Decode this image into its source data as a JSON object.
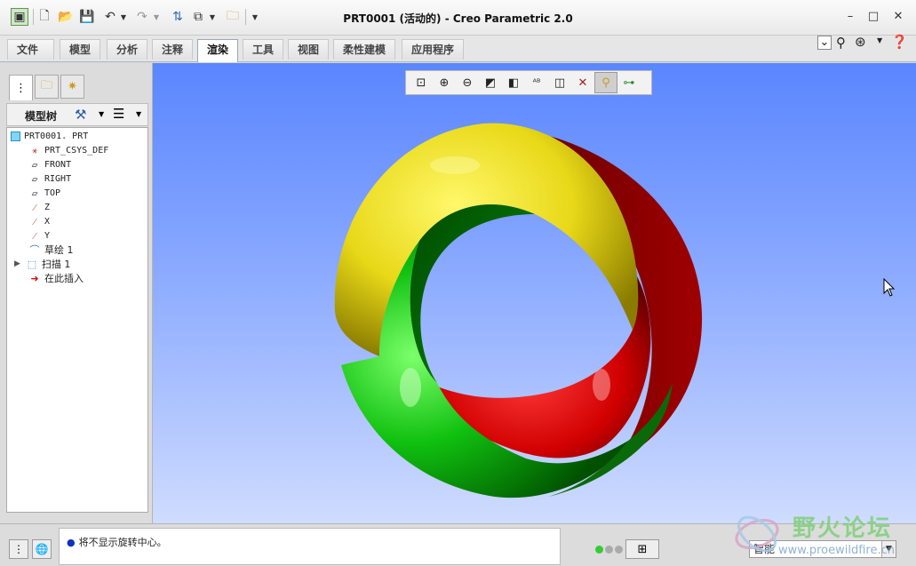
{
  "window": {
    "title": "PRT0001 (活动的) - Creo Parametric 2.0",
    "controls": [
      "–",
      "□",
      "✕"
    ]
  },
  "quick_access": [
    "new-icon",
    "open-icon",
    "save-icon",
    "undo-icon",
    "redo-icon",
    "regenerate-icon",
    "windows-icon",
    "close-window-icon",
    "customize-icon"
  ],
  "tabs": [
    {
      "label": "文件",
      "dropdown": "▾"
    },
    {
      "label": "模型"
    },
    {
      "label": "分析"
    },
    {
      "label": "注释"
    },
    {
      "label": "渲染"
    },
    {
      "label": "工具"
    },
    {
      "label": "视图"
    },
    {
      "label": "柔性建模"
    },
    {
      "label": "应用程序"
    }
  ],
  "active_tab": "渲染",
  "left_panel": {
    "header": "模型树",
    "tree": [
      {
        "label": "PRT0001. PRT",
        "icon": "part-icon"
      },
      {
        "label": "PRT_CSYS_DEF",
        "icon": "csys-icon"
      },
      {
        "label": "FRONT",
        "icon": "datum-plane-icon"
      },
      {
        "label": "RIGHT",
        "icon": "datum-plane-icon"
      },
      {
        "label": "TOP",
        "icon": "datum-plane-icon"
      },
      {
        "label": "Z",
        "icon": "axis-icon"
      },
      {
        "label": "X",
        "icon": "axis-icon"
      },
      {
        "label": "Y",
        "icon": "axis-icon"
      },
      {
        "label": "草绘 1",
        "icon": "sketch-icon"
      },
      {
        "label": "扫描 1",
        "icon": "sweep-icon"
      },
      {
        "label": "在此插入",
        "icon": "insert-here-icon"
      }
    ]
  },
  "status": {
    "message": "将不显示旋转中心。",
    "filter_value": "智能"
  },
  "watermark": {
    "text": "野火论坛",
    "url": "www.proewildfire.cn"
  },
  "colors": {
    "viewport_top": "#5a86ff",
    "viewport_bottom": "#cfdcff",
    "ring_yellow": "#f2e21a",
    "ring_red": "#e00000",
    "ring_green": "#00c000"
  }
}
